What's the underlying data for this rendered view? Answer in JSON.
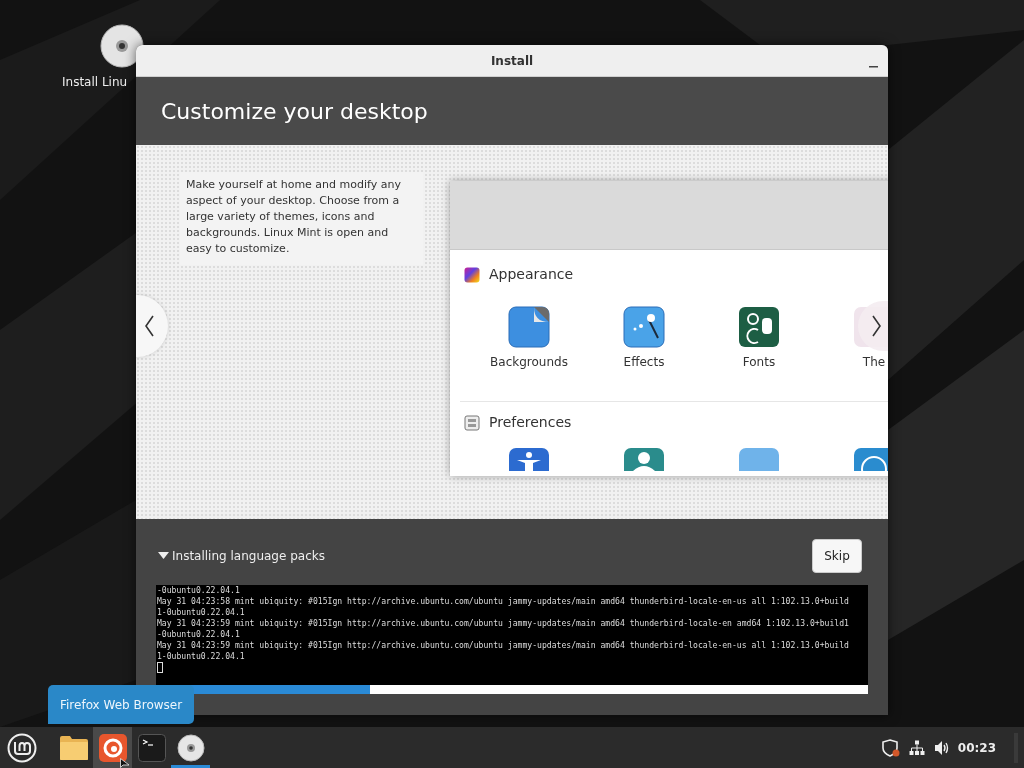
{
  "desktop": {
    "icons": [
      {
        "label": "Install Linu"
      }
    ]
  },
  "window": {
    "title": "Install",
    "heading": "Customize your desktop",
    "slide": {
      "text": "Make yourself at home and modify any aspect of your desktop. Choose from a large variety of themes, icons and backgrounds. Linux Mint is open and easy to customize.",
      "sections": [
        {
          "title": "Appearance",
          "kind": "appearance",
          "items": [
            {
              "label": "Backgrounds",
              "kind": "backgrounds"
            },
            {
              "label": "Effects",
              "kind": "effects"
            },
            {
              "label": "Fonts",
              "kind": "fonts"
            },
            {
              "label": "The",
              "kind": "themes"
            }
          ]
        },
        {
          "title": "Preferences",
          "kind": "preferences",
          "items": [
            {
              "kind": "accessibility"
            },
            {
              "kind": "account"
            },
            {
              "kind": "blank"
            },
            {
              "kind": "clock"
            }
          ]
        }
      ]
    },
    "progress": {
      "title": "Installing language packs",
      "expanded": true,
      "skip": "Skip",
      "level": 0.3,
      "log": [
        "-0ubuntu0.22.04.1",
        "May 31 04:23:58 mint ubiquity: #015Ign http://archive.ubuntu.com/ubuntu jammy-updates/main amd64 thunderbird-locale-en-us all 1:102.13.0+build",
        "1-0ubuntu0.22.04.1",
        "May 31 04:23:59 mint ubiquity: #015Ign http://archive.ubuntu.com/ubuntu jammy-updates/main amd64 thunderbird-locale-en amd64 1:102.13.0+build1",
        "-0ubuntu0.22.04.1",
        "May 31 04:23:59 mint ubiquity: #015Ign http://archive.ubuntu.com/ubuntu jammy-updates/main amd64 thunderbird-locale-en-us all 1:102.13.0+build",
        "1-0ubuntu0.22.04.1"
      ]
    }
  },
  "taskbar": {
    "tooltip": "Firefox Web Browser",
    "apps": [
      {
        "kind": "files",
        "hovered": false,
        "running": false
      },
      {
        "kind": "firefox",
        "hovered": true,
        "running": false
      },
      {
        "kind": "terminal",
        "hovered": false,
        "running": false
      },
      {
        "kind": "disc",
        "hovered": false,
        "running": true
      }
    ],
    "clock": "00:23"
  }
}
